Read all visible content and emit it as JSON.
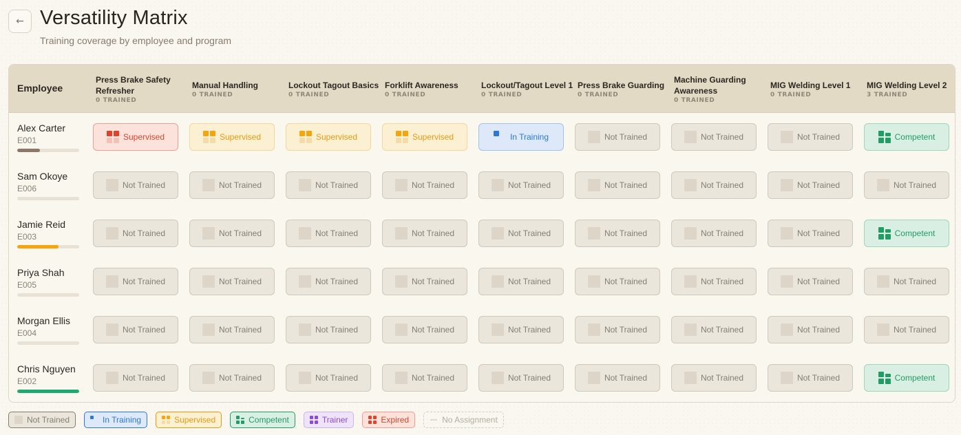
{
  "header": {
    "title": "Versatility Matrix",
    "subtitle": "Training coverage by employee and program",
    "back_icon": "arrow-left-icon"
  },
  "table": {
    "employee_header": "Employee",
    "columns": [
      {
        "name": "Press Brake Safety Refresher",
        "count": "0 TRAINED"
      },
      {
        "name": "Manual Handling",
        "count": "0 TRAINED"
      },
      {
        "name": "Lockout Tagout Basics",
        "count": "0 TRAINED"
      },
      {
        "name": "Forklift Awareness",
        "count": "0 TRAINED"
      },
      {
        "name": "Lockout/Tagout Level 1",
        "count": "0 TRAINED"
      },
      {
        "name": "Press Brake Guarding",
        "count": "0 TRAINED"
      },
      {
        "name": "Machine Guarding Awareness",
        "count": "0 TRAINED"
      },
      {
        "name": "MIG Welding Level 1",
        "count": "0 TRAINED"
      },
      {
        "name": "MIG Welding Level 2",
        "count": "3 TRAINED"
      }
    ],
    "rows": [
      {
        "name": "Alex Carter",
        "id": "E001",
        "progress": 0.37,
        "progress_color": "#8c776a",
        "cells": [
          "sup-red",
          "sup",
          "sup",
          "sup",
          "int",
          "not",
          "not",
          "not",
          "comp"
        ]
      },
      {
        "name": "Sam Okoye",
        "id": "E006",
        "progress": 0,
        "progress_color": "#e8e2d6",
        "cells": [
          "not",
          "not",
          "not",
          "not",
          "not",
          "not",
          "not",
          "not",
          "not"
        ]
      },
      {
        "name": "Jamie Reid",
        "id": "E003",
        "progress": 0.67,
        "progress_color": "#f5a50e",
        "cells": [
          "not",
          "not",
          "not",
          "not",
          "not",
          "not",
          "not",
          "not",
          "comp"
        ]
      },
      {
        "name": "Priya Shah",
        "id": "E005",
        "progress": 0,
        "progress_color": "#e8e2d6",
        "cells": [
          "not",
          "not",
          "not",
          "not",
          "not",
          "not",
          "not",
          "not",
          "not"
        ]
      },
      {
        "name": "Morgan Ellis",
        "id": "E004",
        "progress": 0,
        "progress_color": "#e8e2d6",
        "cells": [
          "not",
          "not",
          "not",
          "not",
          "not",
          "not",
          "not",
          "not",
          "not"
        ]
      },
      {
        "name": "Chris Nguyen",
        "id": "E002",
        "progress": 1.0,
        "progress_color": "#20a872",
        "cells": [
          "not",
          "not",
          "not",
          "not",
          "not",
          "not",
          "not",
          "not",
          "comp"
        ]
      }
    ]
  },
  "status_labels": {
    "not": "Not Trained",
    "sup": "Supervised",
    "sup-red": "Supervised",
    "int": "In Training",
    "comp": "Competent"
  },
  "legend": [
    {
      "key": "not",
      "label": "Not Trained"
    },
    {
      "key": "int",
      "label": "In Training"
    },
    {
      "key": "sup",
      "label": "Supervised"
    },
    {
      "key": "comp",
      "label": "Competent"
    },
    {
      "key": "trainer",
      "label": "Trainer"
    },
    {
      "key": "exp",
      "label": "Expired"
    },
    {
      "key": "none",
      "label": "No Assignment"
    }
  ],
  "colors": {
    "not": "#d9d2c4",
    "sup": "#f5a50e",
    "sup-red": "#e0432c",
    "int": "#2d78d4",
    "comp": "#229c64",
    "trainer": "#8a4bd6",
    "exp": "#e0432c"
  }
}
